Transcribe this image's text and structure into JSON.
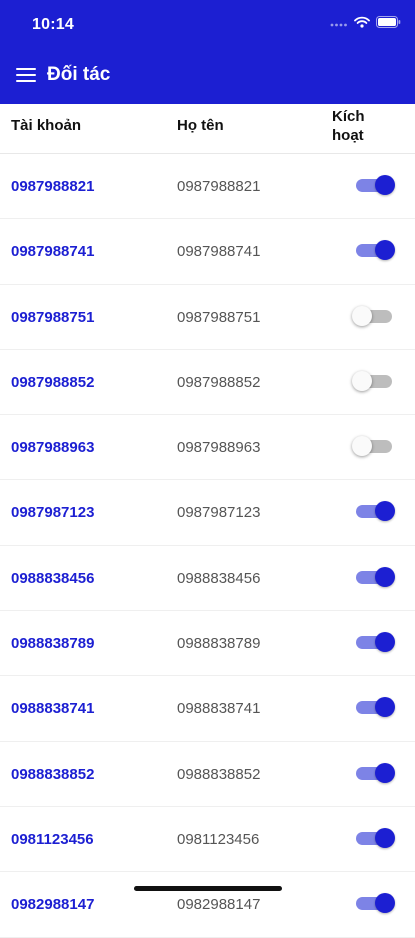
{
  "status_bar": {
    "time": "10:14"
  },
  "app_bar": {
    "title": "Đối tác",
    "menu_icon": "hamburger-menu-icon"
  },
  "columns": {
    "account": "Tài khoản",
    "name": "Họ tên",
    "active_line1": "Kích",
    "active_line2": "hoạt"
  },
  "colors": {
    "primary": "#1c1fd2",
    "switch_track_on": "#7d83e6",
    "switch_off": "#bdbdbd"
  },
  "partners": [
    {
      "account": "0987988821",
      "name": "0987988821",
      "active": true
    },
    {
      "account": "0987988741",
      "name": "0987988741",
      "active": true
    },
    {
      "account": "0987988751",
      "name": "0987988751",
      "active": false
    },
    {
      "account": "0987988852",
      "name": "0987988852",
      "active": false
    },
    {
      "account": "0987988963",
      "name": "0987988963",
      "active": false
    },
    {
      "account": "0987987123",
      "name": "0987987123",
      "active": true
    },
    {
      "account": "0988838456",
      "name": "0988838456",
      "active": true
    },
    {
      "account": "0988838789",
      "name": "0988838789",
      "active": true
    },
    {
      "account": "0988838741",
      "name": "0988838741",
      "active": true
    },
    {
      "account": "0988838852",
      "name": "0988838852",
      "active": true
    },
    {
      "account": "0981123456",
      "name": "0981123456",
      "active": true
    },
    {
      "account": "0982988147",
      "name": "0982988147",
      "active": true
    }
  ]
}
